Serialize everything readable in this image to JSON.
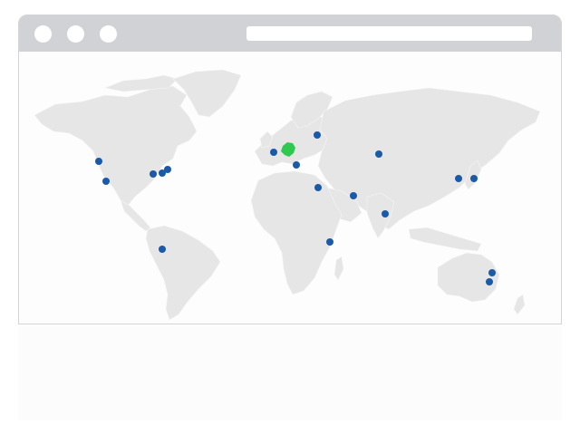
{
  "window": {
    "controls": [
      "close-control",
      "minimize-control",
      "maximize-control"
    ],
    "address_bar_value": ""
  },
  "map": {
    "land_color": "#e6e6e6",
    "marker_color": "#1a5aa8",
    "highlight_color": "#2fc94f",
    "highlight_region": "germany",
    "markers": [
      {
        "id": "seattle"
      },
      {
        "id": "san-francisco"
      },
      {
        "id": "chicago"
      },
      {
        "id": "new-york"
      },
      {
        "id": "boston"
      },
      {
        "id": "bogota"
      },
      {
        "id": "london"
      },
      {
        "id": "stockholm"
      },
      {
        "id": "milan"
      },
      {
        "id": "cairo"
      },
      {
        "id": "dubai"
      },
      {
        "id": "nairobi"
      },
      {
        "id": "bangalore"
      },
      {
        "id": "novosibirsk"
      },
      {
        "id": "seoul"
      },
      {
        "id": "tokyo"
      },
      {
        "id": "sydney"
      },
      {
        "id": "melbourne"
      }
    ]
  }
}
